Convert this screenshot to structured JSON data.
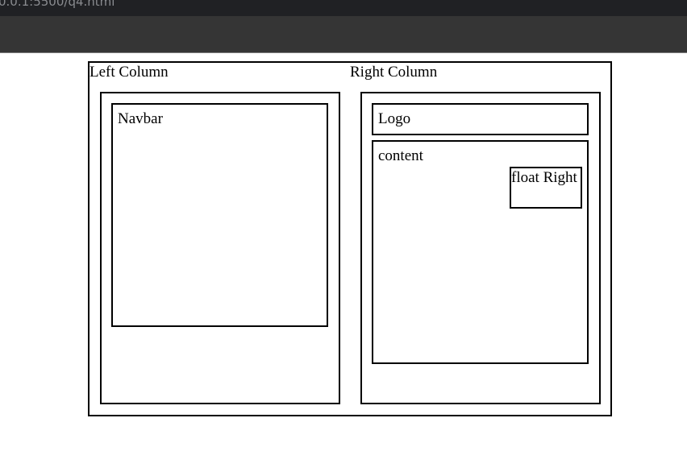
{
  "browser": {
    "address_text": "0.0.1:5500/q4.html"
  },
  "page": {
    "left_column": {
      "heading": "Left Column",
      "navbar_label": "Navbar"
    },
    "right_column": {
      "heading": "Right Column",
      "logo_label": "Logo",
      "content_label": "content",
      "float_label": "float Right"
    }
  }
}
